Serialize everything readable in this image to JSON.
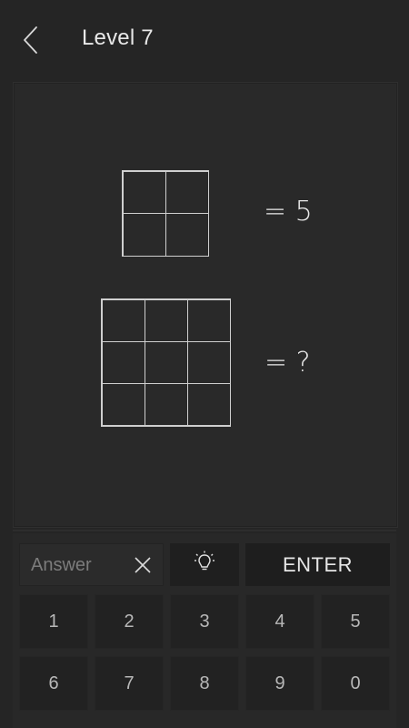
{
  "header": {
    "title": "Level 7"
  },
  "puzzle": {
    "equation_1": "= 5",
    "equation_2": "= ?"
  },
  "answer": {
    "placeholder": "Answer",
    "value": ""
  },
  "enter_label": "ENTER",
  "keys": [
    "1",
    "2",
    "3",
    "4",
    "5",
    "6",
    "7",
    "8",
    "9",
    "0"
  ],
  "colors": {
    "background": "#252525",
    "panel": "#292929",
    "key": "#222222",
    "grid_line": "#cfcfcf"
  }
}
